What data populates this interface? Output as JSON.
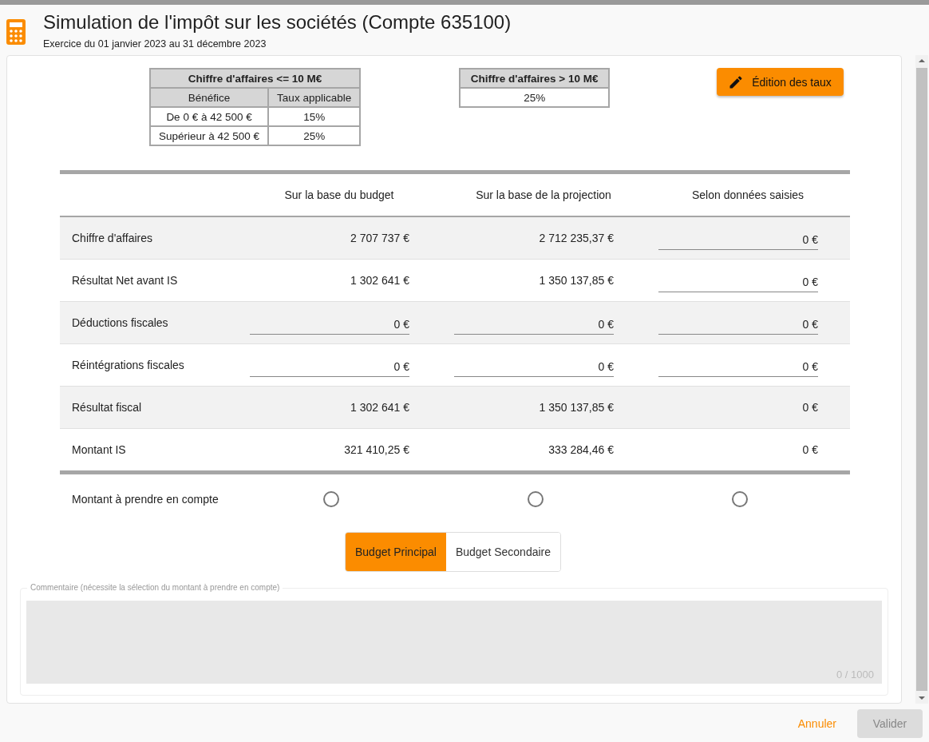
{
  "header": {
    "title": "Simulation de l'impôt sur les sociétés (Compte 635100)",
    "subtitle": "Exercice du 01 janvier 2023 au 31 décembre 2023"
  },
  "rate_table_small": {
    "title": "Chiffre d'affaires <= 10 M€",
    "columns": [
      "Bénéfice",
      "Taux applicable"
    ],
    "rows": [
      [
        "De 0 € à 42 500 €",
        "15%"
      ],
      [
        "Supérieur à 42 500 €",
        "25%"
      ]
    ]
  },
  "rate_table_large": {
    "title": "Chiffre d'affaires > 10 M€",
    "value": "25%"
  },
  "edit_rates_button": {
    "label": "Édition des taux"
  },
  "simulation_table": {
    "columns": [
      "Sur la base du budget",
      "Sur la base de la projection",
      "Selon données saisies"
    ],
    "rows": [
      {
        "label": "Chiffre d'affaires",
        "cells": [
          {
            "kind": "text",
            "value": "2 707 737 €"
          },
          {
            "kind": "text",
            "value": "2 712 235,37 €"
          },
          {
            "kind": "input",
            "value": "0 €"
          }
        ]
      },
      {
        "label": "Résultat Net avant IS",
        "cells": [
          {
            "kind": "text",
            "value": "1 302 641 €"
          },
          {
            "kind": "text",
            "value": "1 350 137,85 €"
          },
          {
            "kind": "input",
            "value": "0 €"
          }
        ]
      },
      {
        "label": "Déductions fiscales",
        "cells": [
          {
            "kind": "input",
            "value": "0 €"
          },
          {
            "kind": "input",
            "value": "0 €"
          },
          {
            "kind": "input",
            "value": "0 €"
          }
        ]
      },
      {
        "label": "Réintégrations fiscales",
        "cells": [
          {
            "kind": "input",
            "value": "0 €"
          },
          {
            "kind": "input",
            "value": "0 €"
          },
          {
            "kind": "input",
            "value": "0 €"
          }
        ]
      },
      {
        "label": "Résultat fiscal",
        "cells": [
          {
            "kind": "text",
            "value": "1 302 641 €"
          },
          {
            "kind": "text",
            "value": "1 350 137,85 €"
          },
          {
            "kind": "text",
            "value": "0 €"
          }
        ]
      },
      {
        "label": "Montant IS",
        "cells": [
          {
            "kind": "text",
            "value": "321 410,25 €"
          },
          {
            "kind": "text",
            "value": "333 284,46 €"
          },
          {
            "kind": "text",
            "value": "0 €"
          }
        ]
      }
    ],
    "choice": {
      "label": "Montant à prendre en compte",
      "options": [
        {
          "selected": false
        },
        {
          "selected": false
        },
        {
          "selected": false
        }
      ]
    }
  },
  "budget_toggle": [
    {
      "label": "Budget Principal",
      "selected": true
    },
    {
      "label": "Budget Secondaire",
      "selected": false
    }
  ],
  "comment": {
    "label": "Commentaire (nécessite la sélection du montant à prendre en compte)",
    "counter": "0 / 1000"
  },
  "footer": {
    "cancel": "Annuler",
    "confirm": {
      "label": "Valider",
      "disabled": true
    }
  }
}
